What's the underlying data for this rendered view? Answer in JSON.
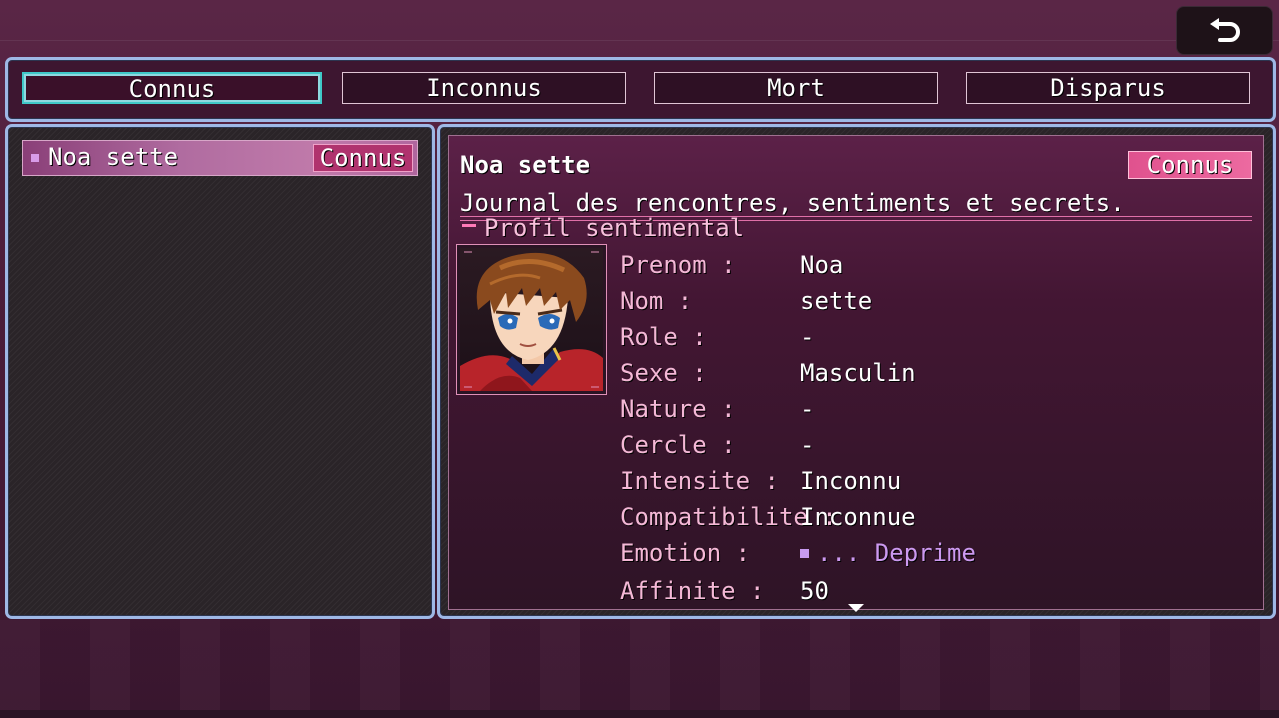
{
  "tabs": [
    {
      "label": "Connus",
      "selected": true
    },
    {
      "label": "Inconnus",
      "selected": false
    },
    {
      "label": "Mort",
      "selected": false
    },
    {
      "label": "Disparus",
      "selected": false
    }
  ],
  "back_button": {
    "icon": "return-arrow-icon"
  },
  "list": {
    "items": [
      {
        "name": "Noa sette",
        "status": "Connus"
      }
    ]
  },
  "detail": {
    "name": "Noa sette",
    "status": "Connus",
    "description": "Journal des rencontres, sentiments et secrets.",
    "section_title": "Profil sentimental",
    "portrait": "character-portrait-brown-hair-blue-eyes-red-cape",
    "fields": [
      {
        "label": "Prenom :",
        "value": "Noa"
      },
      {
        "label": "Nom :",
        "value": "sette"
      },
      {
        "label": "Role :",
        "value": "-"
      },
      {
        "label": "Sexe :",
        "value": "Masculin"
      },
      {
        "label": "Nature :",
        "value": "-"
      },
      {
        "label": "Cercle :",
        "value": "-"
      },
      {
        "label": "Intensite :",
        "value": "Inconnu"
      },
      {
        "label": "Compatibilite :",
        "value": "Inconnue"
      },
      {
        "label": "Emotion :",
        "value": "... Deprime"
      },
      {
        "label": "Affinite :",
        "value": "50"
      }
    ]
  },
  "colors": {
    "frame_border": "#9fb8e6",
    "label_pink": "#f4b8d6",
    "emotion_purple": "#cc99f0",
    "status_pink": "#e0528e"
  }
}
